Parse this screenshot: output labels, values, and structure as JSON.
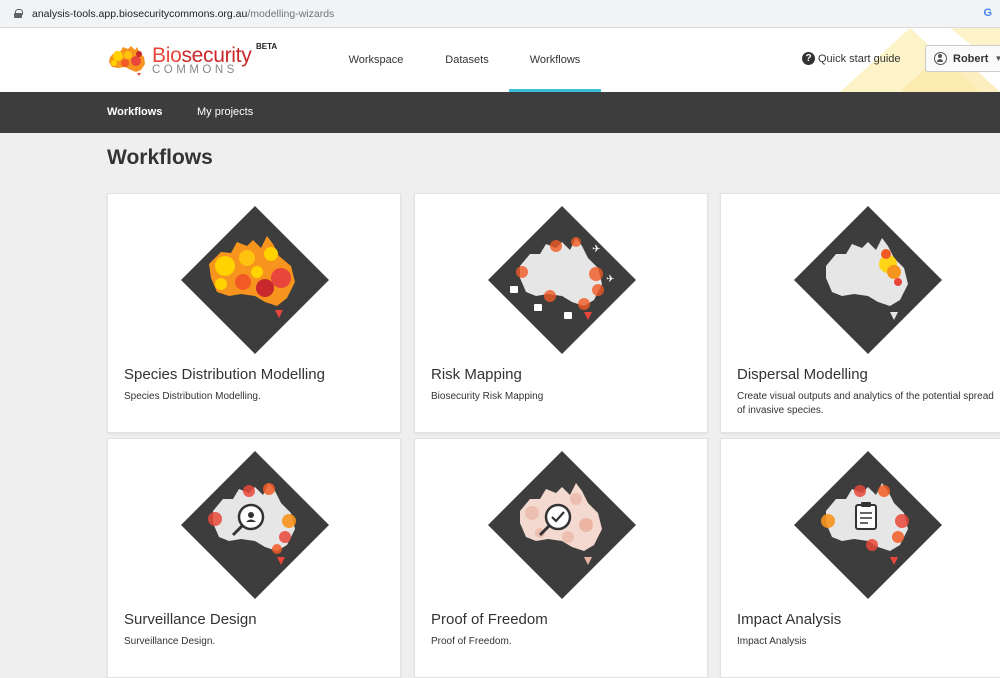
{
  "browser": {
    "url_domain": "analysis-tools.app.biosecuritycommons.org.au",
    "url_path": "/modelling-wizards",
    "g_icon": "G"
  },
  "header": {
    "logo": {
      "bio": "Bio",
      "security": "security",
      "beta": "BETA",
      "commons": "COMMONS"
    },
    "nav": [
      {
        "label": "Workspace"
      },
      {
        "label": "Datasets"
      },
      {
        "label": "Workflows",
        "active": true
      }
    ],
    "quick_start": "Quick start guide",
    "quick_icon": "?",
    "user": "Robert"
  },
  "subnav": {
    "items": [
      {
        "label": "Workflows",
        "active": true
      },
      {
        "label": "My projects"
      }
    ]
  },
  "page": {
    "title": "Workflows"
  },
  "cards": [
    {
      "title": "Species Distribution Modelling",
      "desc": "Species Distribution Modelling.",
      "icon": "heatmap-australia-icon"
    },
    {
      "title": "Risk Mapping",
      "desc": "Biosecurity Risk Mapping",
      "icon": "risk-map-icon"
    },
    {
      "title": "Dispersal Modelling",
      "desc": "Create visual outputs and analytics of the potential spread of invasive species.",
      "icon": "dispersal-map-icon"
    },
    {
      "title": "Surveillance Design",
      "desc": "Surveillance Design.",
      "icon": "surveillance-magnifier-icon"
    },
    {
      "title": "Proof of Freedom",
      "desc": "Proof of Freedom.",
      "icon": "proof-checkmark-icon"
    },
    {
      "title": "Impact Analysis",
      "desc": "Impact Analysis",
      "icon": "impact-clipboard-icon"
    }
  ],
  "colors": {
    "accent": "#3bbfd9",
    "subnav": "#3d3d3d",
    "diamond": "#3d3d3d",
    "brand_red": "#e8463a",
    "heat_orange": "#f7941d",
    "heat_yellow": "#ffd200"
  }
}
